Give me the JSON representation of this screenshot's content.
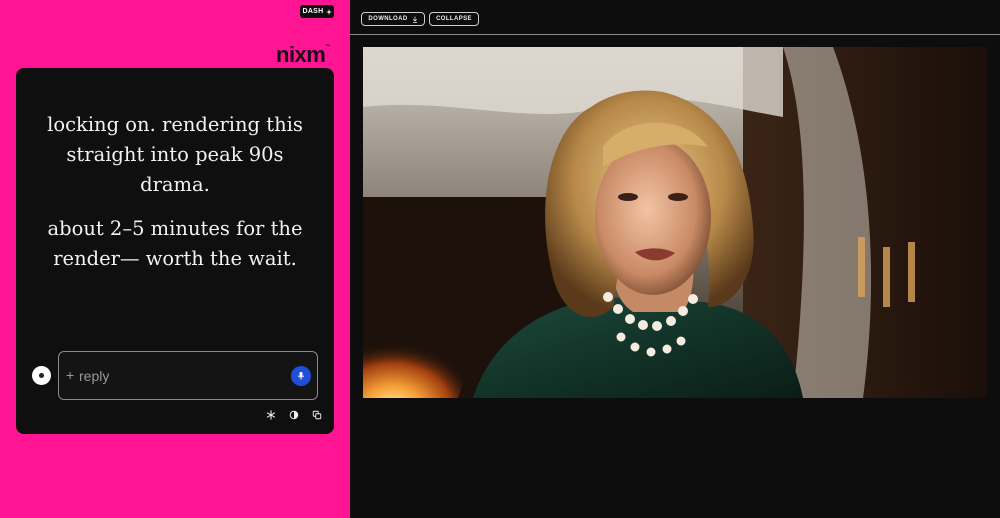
{
  "header": {
    "dash_label": "DASH",
    "logo_text": "nixm",
    "logo_mark": "™"
  },
  "chat": {
    "message_1": "locking on. rendering this straight into peak 90s drama.",
    "message_2": "about 2–5 minutes for the render— worth the wait."
  },
  "composer": {
    "plus_symbol": "+",
    "placeholder": "reply"
  },
  "toolbar": {
    "download_label": "DOWNLOAD",
    "collapse_label": "COLLAPSE"
  },
  "icons": {
    "dash": "sparkle-icon",
    "avatar": "avatar-dot-icon",
    "mic": "mic-icon",
    "tools": [
      "snowflake-icon",
      "contrast-icon",
      "copy-icon"
    ],
    "download": "download-icon"
  },
  "colors": {
    "left_panel": "#ff1493",
    "card": "#0f0f0f",
    "mic": "#1f4fd6",
    "dark": "#0d0d0d"
  }
}
